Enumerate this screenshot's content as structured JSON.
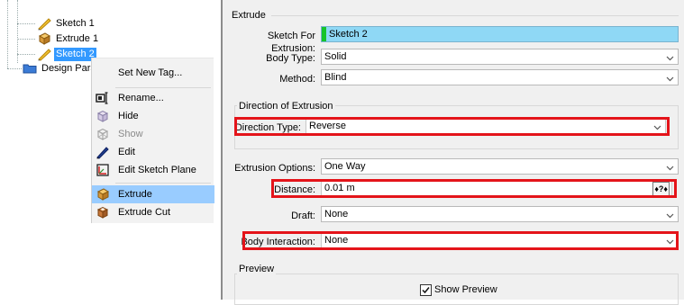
{
  "tree": {
    "items": [
      {
        "label": "Sketch 1",
        "icon": "sketch-pencil-icon"
      },
      {
        "label": "Extrude 1",
        "icon": "extrude-icon"
      },
      {
        "label": "Sketch 2",
        "icon": "sketch-pencil-icon",
        "selected": true
      },
      {
        "label": "Design Paran",
        "icon": "folder-icon"
      }
    ]
  },
  "context_menu": {
    "items": [
      {
        "label": "Set New Tag...",
        "icon": "",
        "disabled": false
      },
      {
        "label": "Rename...",
        "icon": "rename-icon",
        "disabled": false
      },
      {
        "label": "Hide",
        "icon": "hide-cube-icon",
        "disabled": false
      },
      {
        "label": "Show",
        "icon": "show-cube-icon",
        "disabled": true
      },
      {
        "label": "Edit",
        "icon": "pencil-icon",
        "disabled": false
      },
      {
        "label": "Edit Sketch Plane",
        "icon": "sketch-plane-icon",
        "disabled": false
      },
      {
        "label": "Extrude",
        "icon": "extrude-icon",
        "disabled": false,
        "highlighted": true
      },
      {
        "label": "Extrude Cut",
        "icon": "extrude-cut-icon",
        "disabled": false
      }
    ]
  },
  "panel": {
    "section_title": "Extrude",
    "sketch_for_extrusion": {
      "label": "Sketch For Extrusion:",
      "value": "Sketch 2"
    },
    "body_type": {
      "label": "Body Type:",
      "value": "Solid"
    },
    "method": {
      "label": "Method:",
      "value": "Blind"
    },
    "direction_group": {
      "title": "Direction of Extrusion",
      "direction_type": {
        "label": "Direction Type:",
        "value": "Reverse"
      }
    },
    "extrusion_options": {
      "label": "Extrusion Options:",
      "value": "One Way"
    },
    "distance": {
      "label": "Distance:",
      "value": "0.01 m",
      "button": "♦?♦"
    },
    "draft": {
      "label": "Draft:",
      "value": "None"
    },
    "body_interaction": {
      "label": "Body Interaction:",
      "value": "None"
    },
    "preview_group": {
      "title": "Preview",
      "show_preview": {
        "label": "Show Preview",
        "checked": true
      }
    }
  },
  "colors": {
    "selection": "#3399ff",
    "menu_highlight": "#99ccff",
    "annotation_red": "#e4141a",
    "sketch_field": "#8fd8f5",
    "valid_marker": "#16c42a"
  }
}
